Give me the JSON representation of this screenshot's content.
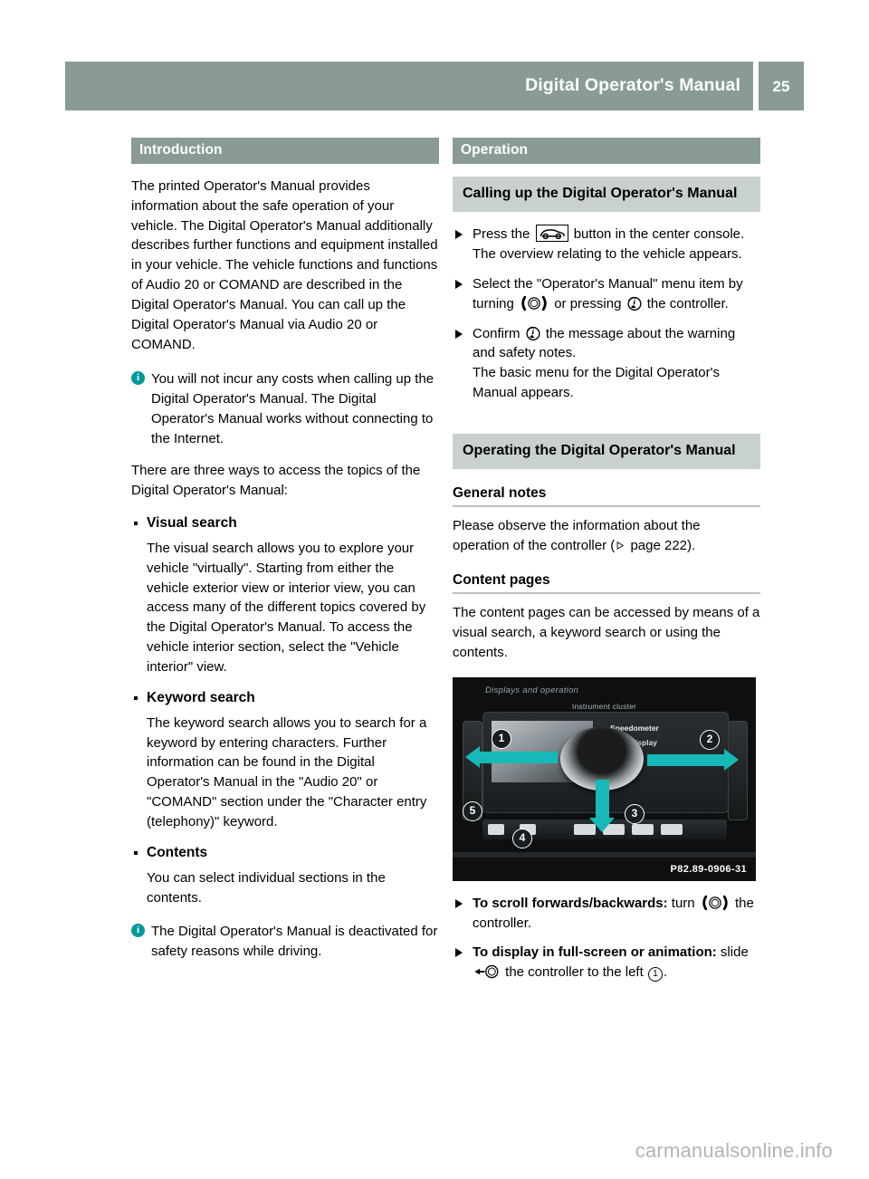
{
  "header": {
    "title": "Digital Operator's Manual",
    "page_number": "25"
  },
  "left_column": {
    "section_title": "Introduction",
    "intro_paragraph": "The printed Operator's Manual provides information about the safe operation of your vehicle. The Digital Operator's Manual additionally describes further functions and equipment installed in your vehicle. The vehicle functions and functions of Audio 20 or COMAND are described in the Digital Operator's Manual. You can call up the Digital Operator's Manual via Audio 20 or COMAND.",
    "note_1": "You will not incur any costs when calling up the Digital Operator's Manual. The Digital Operator's Manual works without connecting to the Internet.",
    "access_paragraph": "There are three ways to access the topics of the Digital Operator's Manual:",
    "bullets": [
      {
        "title": "Visual search",
        "body": "The visual search allows you to explore your vehicle \"virtually\". Starting from either the vehicle exterior view or interior view, you can access many of the different topics covered by the Digital Operator's Manual. To access the vehicle interior section, select the \"Vehicle interior\" view."
      },
      {
        "title": "Keyword search",
        "body": "The keyword search allows you to search for a keyword by entering characters. Further information can be found in the Digital Operator's Manual in the \"Audio 20\" or \"COMAND\" section under the \"Character entry (telephony)\" keyword."
      },
      {
        "title": "Contents",
        "body": "You can select individual sections in the contents."
      }
    ],
    "note_2": "The Digital Operator's Manual is deactivated for safety reasons while driving."
  },
  "right_column": {
    "section_title": "Operation",
    "sub_heading_1": "Calling up the Digital Operator's Manual",
    "steps_1": [
      {
        "pre": "Press the ",
        "icon": "car-button-icon",
        "post": " button in the center console.",
        "result": "The overview relating to the vehicle appears."
      },
      {
        "pre": "Select the \"Operator's Manual\" menu item by turning ",
        "icon": "controller-turn-icon",
        "mid": " or pressing ",
        "icon2": "controller-press-icon",
        "post": " the controller.",
        "result": ""
      },
      {
        "pre": "Confirm ",
        "icon": "controller-press-icon",
        "post": " the message about the warning and safety notes.",
        "result": "The basic menu for the Digital Operator's Manual appears."
      }
    ],
    "sub_heading_2": "Operating the Digital Operator's Manual",
    "heading_general_notes": "General notes",
    "general_notes_pre": "Please observe the information about the operation of the controller (",
    "general_notes_ref": " page 222).",
    "heading_content_pages": "Content pages",
    "content_pages_body": "The content pages can be accessed by means of a visual search, a keyword search or using the contents.",
    "figure": {
      "caption_top": "Displays and operation",
      "caption_sub": "Instrument cluster",
      "label_speedometer": "Speedometer",
      "label_display": "on display",
      "callouts": [
        "1",
        "2",
        "3",
        "4",
        "5"
      ],
      "code": "P82.89-0906-31"
    },
    "steps_2": [
      {
        "strong": "To scroll forwards/backwards:",
        "pre": " turn ",
        "icon": "controller-turn-icon",
        "post": " the controller."
      },
      {
        "strong": "To display in full-screen or animation:",
        "pre": " slide ",
        "icon": "controller-slide-left-icon",
        "post": " the controller to the left ",
        "callout": "1",
        "tail": "."
      }
    ]
  },
  "watermark": "carmanualsonline.info",
  "colors": {
    "band": "#8a9b97",
    "sub_band": "#c9d1ce",
    "info_icon": "#009a9a",
    "figure_arrow": "#17b8b8"
  }
}
